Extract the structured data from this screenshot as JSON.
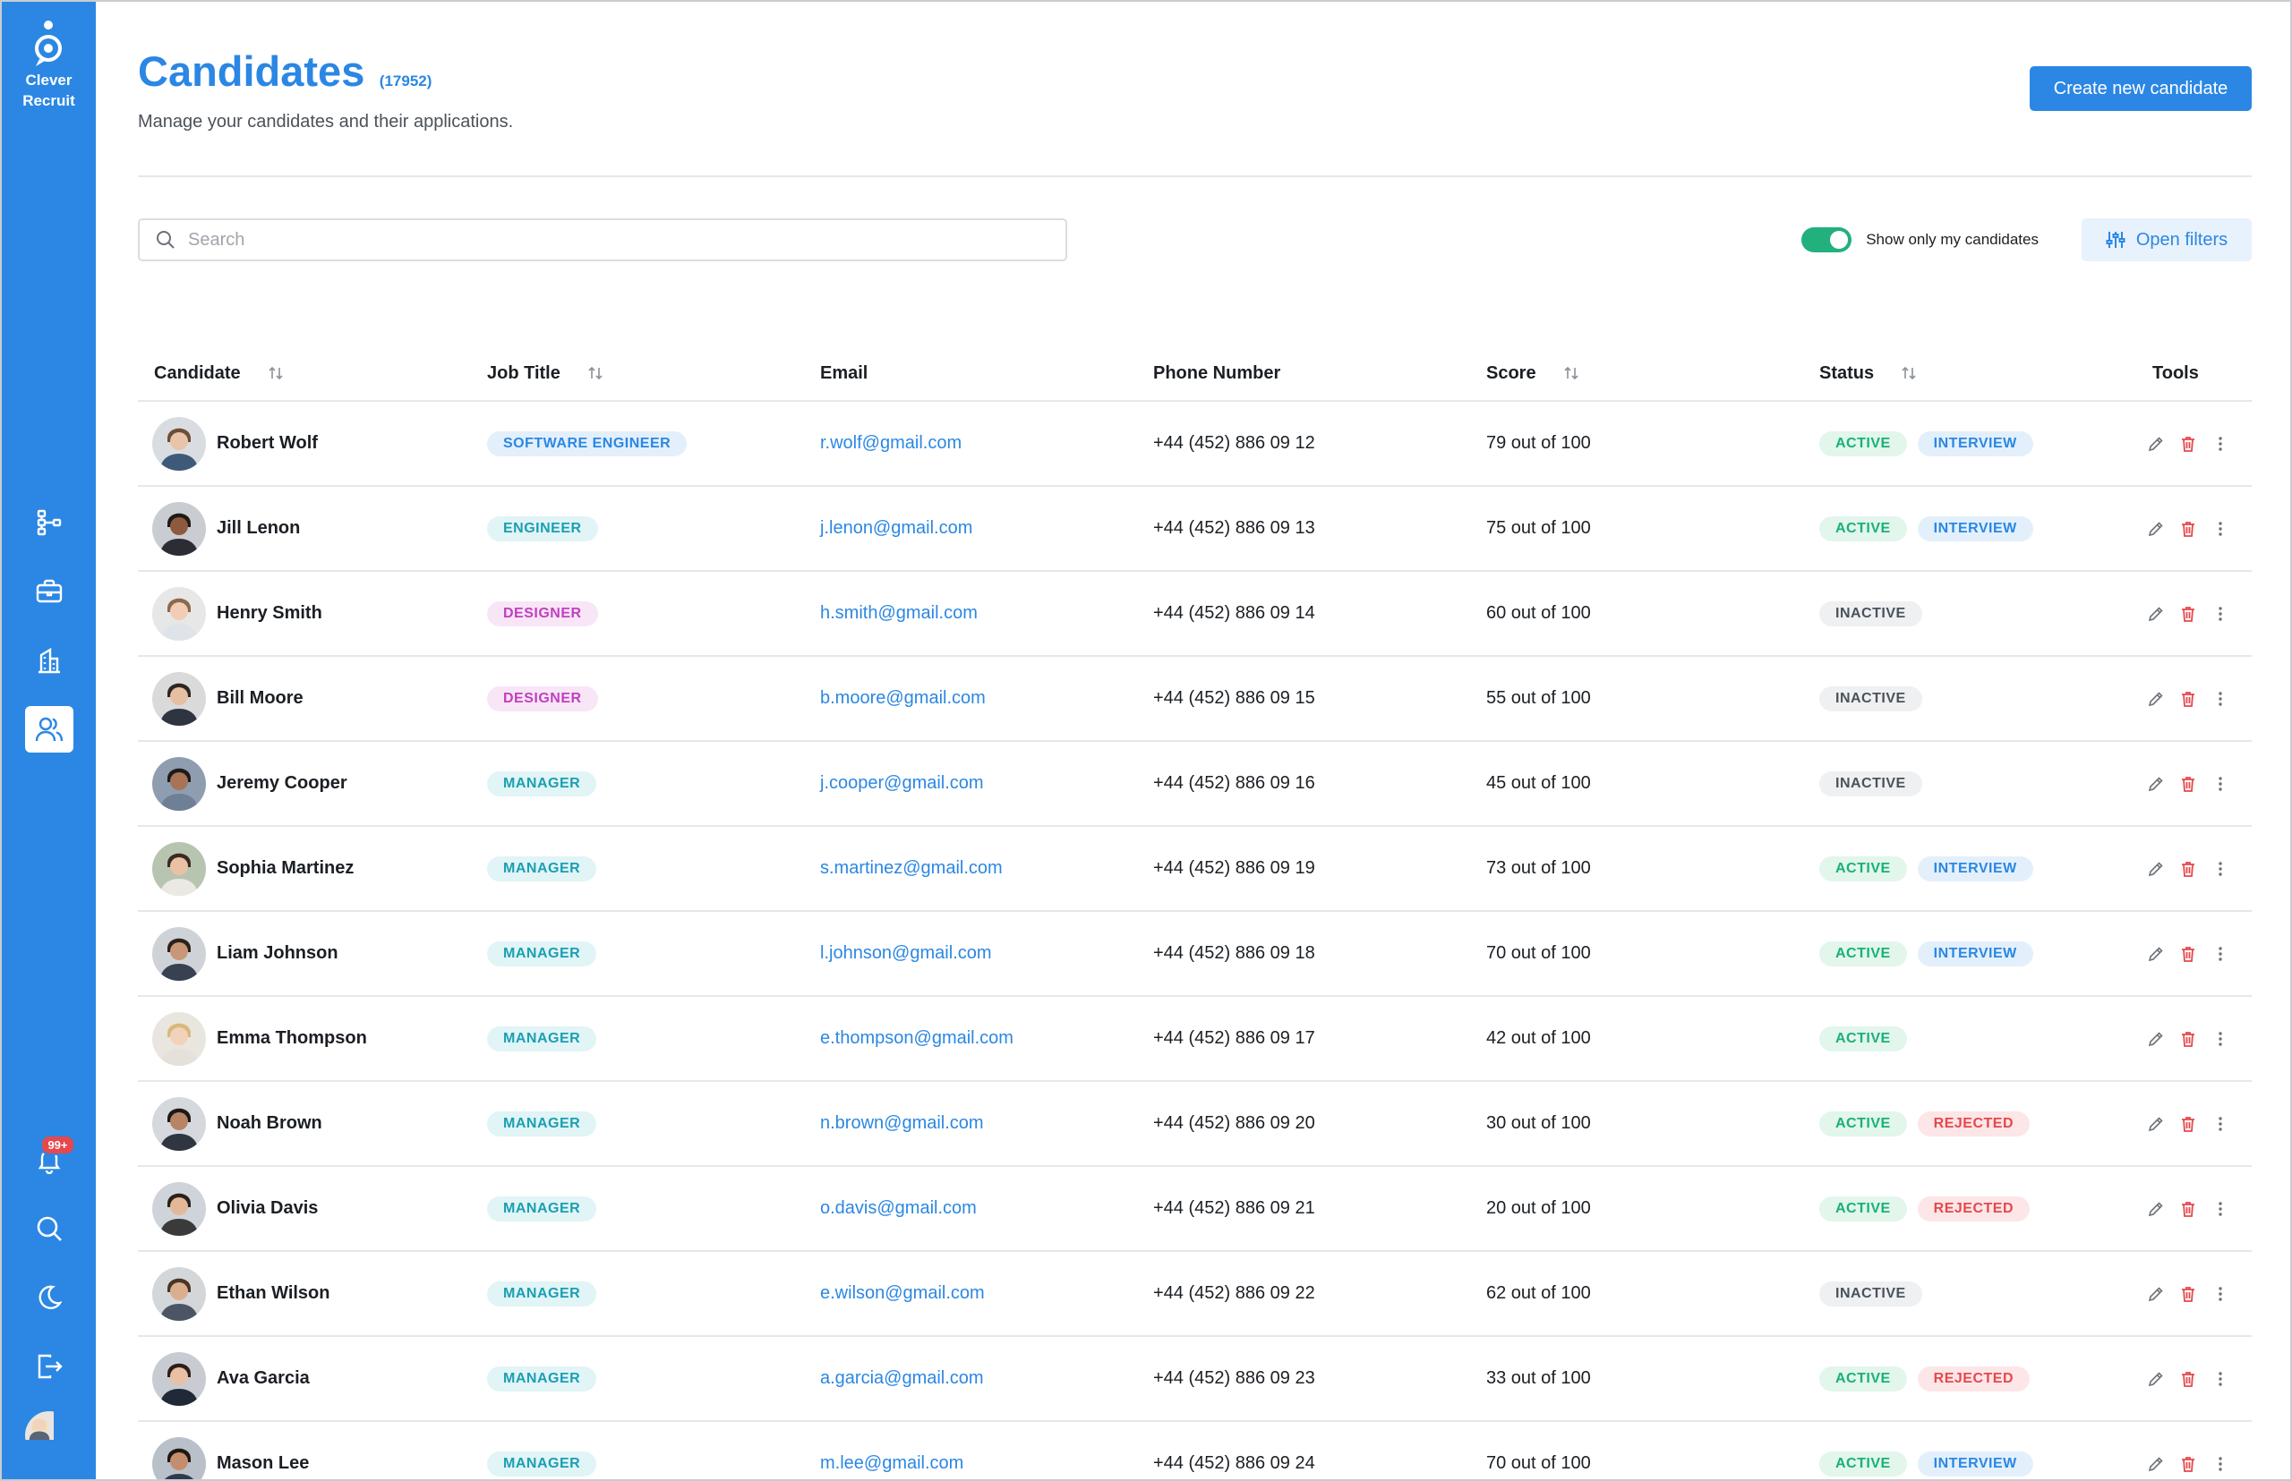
{
  "app": {
    "logo_line1": "Clever",
    "logo_line2": "Recruit",
    "notification_count": "99+",
    "brand_color": "#2b87e3"
  },
  "sidebar": {
    "top_items": [
      {
        "icon": "hierarchy-icon"
      },
      {
        "icon": "briefcase-icon"
      },
      {
        "icon": "building-icon"
      },
      {
        "icon": "users-icon",
        "active": true
      }
    ],
    "bottom_items": [
      {
        "icon": "bell-icon"
      },
      {
        "icon": "search-icon"
      },
      {
        "icon": "moon-icon"
      },
      {
        "icon": "logout-icon"
      },
      {
        "icon": "avatar"
      }
    ]
  },
  "header": {
    "title": "Candidates",
    "count": "(17952)",
    "subtitle": "Manage your candidates and their applications.",
    "create_label": "Create new candidate"
  },
  "toolbar": {
    "search_placeholder": "Search",
    "toggle_label": "Show only my candidates",
    "toggle_on": true,
    "filters_label": "Open filters"
  },
  "table": {
    "headers": {
      "candidate": "Candidate",
      "job_title": "Job Title",
      "email": "Email",
      "phone": "Phone Number",
      "score": "Score",
      "status": "Status",
      "tools": "Tools"
    },
    "rows": [
      {
        "name": "Robert Wolf",
        "job": "SOFTWARE ENGINEER",
        "email": "r.wolf@gmail.com",
        "phone": "+44 (452) 886 09 12",
        "score": "79 out of 100",
        "status1": "ACTIVE",
        "status2": "INTERVIEW"
      },
      {
        "name": "Jill Lenon",
        "job": "ENGINEER",
        "email": "j.lenon@gmail.com",
        "phone": "+44 (452) 886 09 13",
        "score": "75 out of 100",
        "status1": "ACTIVE",
        "status2": "INTERVIEW"
      },
      {
        "name": "Henry Smith",
        "job": "DESIGNER",
        "email": "h.smith@gmail.com",
        "phone": "+44 (452) 886 09 14",
        "score": "60 out of 100",
        "status1": "INACTIVE",
        "status2": ""
      },
      {
        "name": "Bill Moore",
        "job": "DESIGNER",
        "email": "b.moore@gmail.com",
        "phone": "+44 (452) 886 09 15",
        "score": "55 out of 100",
        "status1": "INACTIVE",
        "status2": ""
      },
      {
        "name": "Jeremy Cooper",
        "job": "MANAGER",
        "email": "j.cooper@gmail.com",
        "phone": "+44 (452) 886 09 16",
        "score": "45 out of 100",
        "status1": "INACTIVE",
        "status2": ""
      },
      {
        "name": "Sophia Martinez",
        "job": "MANAGER",
        "email": "s.martinez@gmail.com",
        "phone": "+44 (452) 886 09 19",
        "score": "73 out of 100",
        "status1": "ACTIVE",
        "status2": "INTERVIEW"
      },
      {
        "name": "Liam Johnson",
        "job": "MANAGER",
        "email": "l.johnson@gmail.com",
        "phone": "+44 (452) 886 09 18",
        "score": "70 out of 100",
        "status1": "ACTIVE",
        "status2": "INTERVIEW"
      },
      {
        "name": "Emma Thompson",
        "job": "MANAGER",
        "email": "e.thompson@gmail.com",
        "phone": "+44 (452) 886 09 17",
        "score": "42 out of 100",
        "status1": "ACTIVE",
        "status2": ""
      },
      {
        "name": "Noah Brown",
        "job": "MANAGER",
        "email": "n.brown@gmail.com",
        "phone": "+44 (452) 886 09 20",
        "score": "30 out of 100",
        "status1": "ACTIVE",
        "status2": "REJECTED"
      },
      {
        "name": "Olivia Davis",
        "job": "MANAGER",
        "email": "o.davis@gmail.com",
        "phone": "+44 (452) 886 09 21",
        "score": "20 out of 100",
        "status1": "ACTIVE",
        "status2": "REJECTED"
      },
      {
        "name": "Ethan Wilson",
        "job": "MANAGER",
        "email": "e.wilson@gmail.com",
        "phone": "+44 (452) 886 09 22",
        "score": "62 out of 100",
        "status1": "INACTIVE",
        "status2": ""
      },
      {
        "name": "Ava Garcia",
        "job": "MANAGER",
        "email": "a.garcia@gmail.com",
        "phone": "+44 (452) 886 09 23",
        "score": "33 out of 100",
        "status1": "ACTIVE",
        "status2": "REJECTED"
      },
      {
        "name": "Mason Lee",
        "job": "MANAGER",
        "email": "m.lee@gmail.com",
        "phone": "+44 (452) 886 09 24",
        "score": "70 out of 100",
        "status1": "ACTIVE",
        "status2": "INTERVIEW"
      }
    ]
  }
}
